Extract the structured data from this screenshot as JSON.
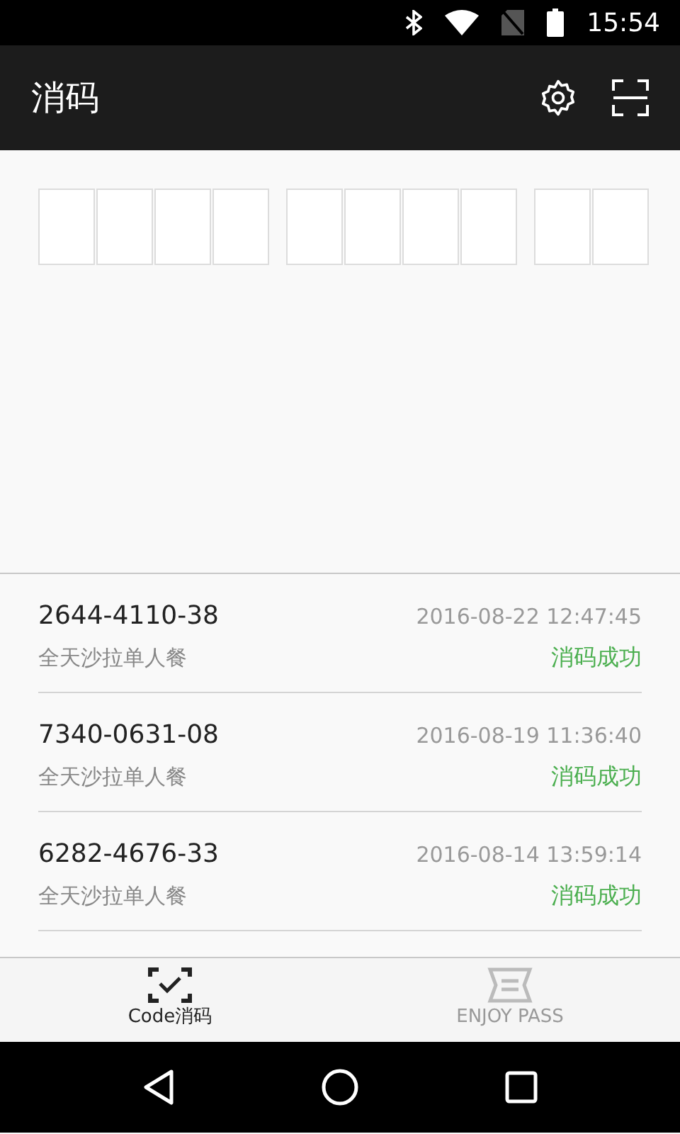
{
  "status_bar": {
    "time": "15:54"
  },
  "app_bar": {
    "title": "消码"
  },
  "records": [
    {
      "code": "2644-4110-38",
      "product": "全天沙拉单人餐",
      "time": "2016-08-22 12:47:45",
      "status": "消码成功",
      "kind": "success"
    },
    {
      "code": "7340-0631-08",
      "product": "全天沙拉单人餐",
      "time": "2016-08-19 11:36:40",
      "status": "消码成功",
      "kind": "success"
    },
    {
      "code": "6282-4676-33",
      "product": "全天沙拉单人餐",
      "time": "2016-08-14 13:59:14",
      "status": "消码成功",
      "kind": "success"
    }
  ],
  "tabs": [
    {
      "label": "Code消码",
      "kind": "code",
      "selected": true
    },
    {
      "label": "ENJOY PASS",
      "kind": "ticket",
      "selected": false
    }
  ]
}
